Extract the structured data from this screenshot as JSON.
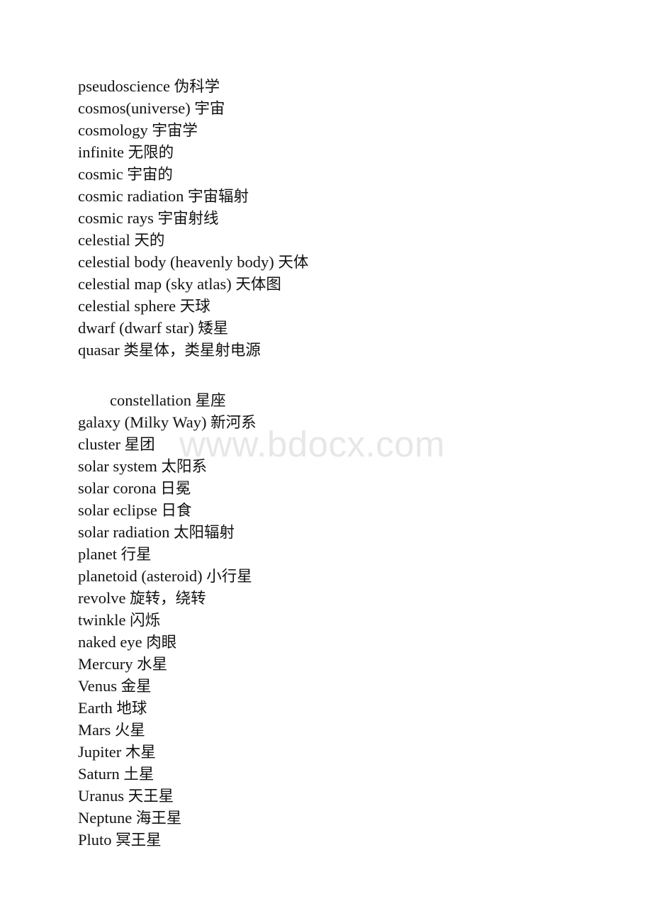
{
  "document": {
    "watermark": "www.bdocx.com",
    "background_color": "#ffffff",
    "text_color": "#111111",
    "watermark_color": "#e7e7e7"
  },
  "blocks": [
    {
      "id": "block-1",
      "entries": [
        {
          "en": "pseudoscience",
          "zh": "伪科学",
          "indented": false
        },
        {
          "en": "cosmos(universe)",
          "zh": "宇宙",
          "indented": false
        },
        {
          "en": "cosmology",
          "zh": "宇宙学",
          "indented": false
        },
        {
          "en": "infinite",
          "zh": "无限的",
          "indented": false
        },
        {
          "en": "cosmic",
          "zh": "宇宙的",
          "indented": false
        },
        {
          "en": "cosmic radiation",
          "zh": "宇宙辐射",
          "indented": false
        },
        {
          "en": "cosmic rays",
          "zh": "宇宙射线",
          "indented": false
        },
        {
          "en": "celestial",
          "zh": "天的",
          "indented": false
        },
        {
          "en": "celestial body (heavenly body)",
          "zh": "天体",
          "indented": false
        },
        {
          "en": "celestial map (sky atlas)",
          "zh": "天体图",
          "indented": false
        },
        {
          "en": "celestial sphere",
          "zh": "天球",
          "indented": false
        },
        {
          "en": "dwarf (dwarf star)",
          "zh": "矮星",
          "indented": false
        },
        {
          "en": "quasar",
          "zh": "类星体，类星射电源",
          "indented": false
        }
      ]
    },
    {
      "id": "block-2",
      "entries": [
        {
          "en": "constellation",
          "zh": "星座",
          "indented": true
        },
        {
          "en": "galaxy (Milky Way)",
          "zh": "新河系",
          "indented": false
        },
        {
          "en": "cluster",
          "zh": "星团",
          "indented": false
        },
        {
          "en": "solar system",
          "zh": "太阳系",
          "indented": false
        },
        {
          "en": "solar corona",
          "zh": "日冕",
          "indented": false
        },
        {
          "en": "solar eclipse",
          "zh": "日食",
          "indented": false
        },
        {
          "en": "solar radiation",
          "zh": "太阳辐射",
          "indented": false
        },
        {
          "en": "planet",
          "zh": "行星",
          "indented": false
        },
        {
          "en": "planetoid (asteroid)",
          "zh": "小行星",
          "indented": false
        },
        {
          "en": "revolve",
          "zh": "旋转，绕转",
          "indented": false
        },
        {
          "en": "twinkle",
          "zh": "闪烁",
          "indented": false
        },
        {
          "en": "naked eye",
          "zh": "肉眼",
          "indented": false
        },
        {
          "en": "Mercury",
          "zh": "水星",
          "indented": false
        },
        {
          "en": "Venus",
          "zh": "金星",
          "indented": false
        },
        {
          "en": "Earth",
          "zh": "地球",
          "indented": false
        },
        {
          "en": "Mars",
          "zh": "火星",
          "indented": false
        },
        {
          "en": "Jupiter",
          "zh": "木星",
          "indented": false
        },
        {
          "en": "Saturn",
          "zh": "土星",
          "indented": false
        },
        {
          "en": "Uranus",
          "zh": "天王星",
          "indented": false
        },
        {
          "en": "Neptune",
          "zh": "海王星",
          "indented": false
        },
        {
          "en": "Pluto",
          "zh": "冥王星",
          "indented": false
        }
      ]
    }
  ]
}
